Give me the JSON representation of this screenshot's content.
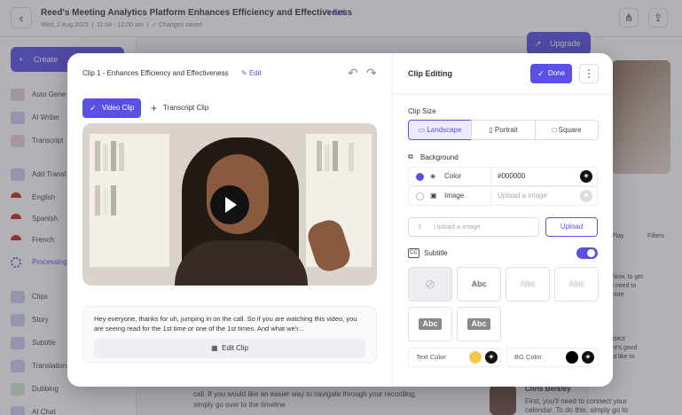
{
  "app": {
    "doc_title": "Reed's Meeting Analytics Platform Enhances Efficiency and Effectiveness",
    "title_edit_label": "Edit",
    "date": "Wed, 2 Aug 2023",
    "time_range": "11:04 - 12:00 am",
    "save_status": "Changes saved",
    "upgrade_label": "Upgrade"
  },
  "sidebar": {
    "create_label": "Create",
    "items": [
      {
        "label": "Auto Gene"
      },
      {
        "label": "AI Writer"
      },
      {
        "label": "Transcript"
      },
      {
        "label": "Add Transl"
      },
      {
        "label": "English"
      },
      {
        "label": "Spanish"
      },
      {
        "label": "French"
      },
      {
        "label": "Processing"
      },
      {
        "label": "Clips"
      },
      {
        "label": "Story"
      },
      {
        "label": "Subtitle"
      },
      {
        "label": "Translation"
      },
      {
        "label": "Dubbing"
      },
      {
        "label": "AI Chat"
      }
    ]
  },
  "background_panel": {
    "play_label": "Play",
    "filters_label": "Filters",
    "snippets": [
      "Now, to get\nI need to\nnote",
      "I need to\nnote",
      "elect\nre's good\n'd like to",
      "I'd like to"
    ],
    "transcript_lines": [
      "call. If you would like an easier way to navigate through your recording,",
      "simply go over to the timeline."
    ],
    "speaker_name": "Chris Berkley",
    "speaker_text": "First, you'll need to connect your\ncalendar. To do this, simply go to"
  },
  "modal": {
    "clip_title": "Clip 1 - Enhances Efficiency and Effectiveness",
    "clip_edit_label": "Edit",
    "tabs": {
      "video_clip": "Video Clip",
      "transcript_clip": "Transcript Clip"
    },
    "transcript_text": "Hey everyone, thanks for uh, jumping in on the call. So if you are watching this video, you are seeing read for the 1st time or one of the 1st times. And what we'r...",
    "edit_clip_label": "Edit Clip",
    "panel_title": "Clip Editing",
    "done_label": "Done",
    "clip_size_label": "Clip Size",
    "sizes": [
      "Landscape",
      "Portrait",
      "Square"
    ],
    "selected_size": "Landscape",
    "background_label": "Background",
    "color_row_label": "Color",
    "color_value": "#000000",
    "image_row_label": "Image",
    "image_placeholder": "Upload a image",
    "upload_placeholder": "Upload a image",
    "upload_label": "Upload",
    "subtitle_label": "Subtitle",
    "subtitle_enabled": true,
    "style_sample": "Abc",
    "text_color_label": "Text Color",
    "text_color": "#f5c84a",
    "bg_color_label": "BG Color",
    "bg_color": "#000000"
  },
  "colors": {
    "accent": "#5b50e6"
  }
}
